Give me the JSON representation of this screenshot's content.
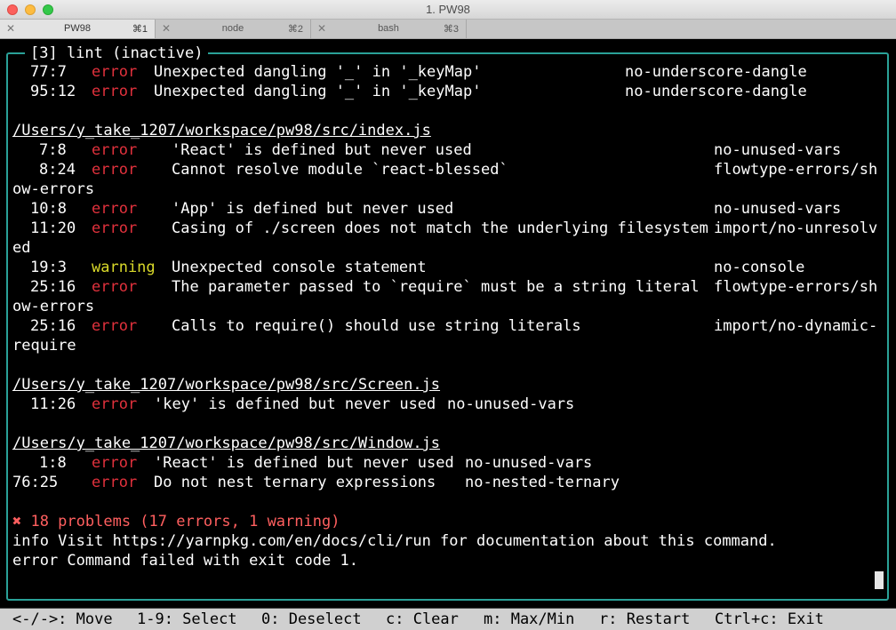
{
  "window": {
    "title": "1. PW98"
  },
  "tabs": [
    {
      "name": "PW98",
      "shortcut": "⌘1",
      "close": "✕"
    },
    {
      "name": "node",
      "shortcut": "⌘2",
      "close": "✕"
    },
    {
      "name": "bash",
      "shortcut": "⌘3",
      "close": "✕"
    }
  ],
  "panel": {
    "title": "[3] lint (inactive)"
  },
  "terminal": {
    "prev": [
      {
        "loc": "77:7",
        "level": "error",
        "msg": "Unexpected dangling '_' in '_keyMap'",
        "rule": "no-underscore-dangle"
      },
      {
        "loc": "95:12",
        "level": "error",
        "msg": "Unexpected dangling '_' in '_keyMap'",
        "rule": "no-underscore-dangle"
      }
    ],
    "index_path": "/Users/y_take_1207/workspace/pw98/src/index.js",
    "index": [
      {
        "loc": "7:8",
        "level": "error",
        "msg": "'React' is defined but never used",
        "rule": "no-unused-vars"
      },
      {
        "loc": "8:24",
        "level": "error",
        "msg": "Cannot resolve module `react-blessed`",
        "rule": "flowtype-errors/sh"
      },
      {
        "wrap": "ow-errors"
      },
      {
        "loc": "10:8",
        "level": "error",
        "msg": "'App' is defined but never used",
        "rule": "no-unused-vars"
      },
      {
        "loc": "11:20",
        "level": "error",
        "msg": "Casing of ./screen does not match the underlying filesystem",
        "rule": "import/no-unresolv"
      },
      {
        "wrap": "ed"
      },
      {
        "loc": "19:3",
        "level": "warning",
        "msg": "Unexpected console statement",
        "rule": "no-console"
      },
      {
        "loc": "25:16",
        "level": "error",
        "msg": "The parameter passed to `require` must be a string literal",
        "rule": "flowtype-errors/sh"
      },
      {
        "wrap": "ow-errors"
      },
      {
        "loc": "25:16",
        "level": "error",
        "msg": "Calls to require() should use string literals",
        "rule": "import/no-dynamic-"
      },
      {
        "wrap": "require"
      }
    ],
    "screen_path": "/Users/y_take_1207/workspace/pw98/src/Screen.js",
    "screen": [
      {
        "loc": "11:26",
        "level": "error",
        "msg": "'key' is defined but never used",
        "rule": "no-unused-vars"
      }
    ],
    "window_path": "/Users/y_take_1207/workspace/pw98/src/Window.js",
    "window_file": [
      {
        "loc": "1:8",
        "level": "error",
        "msg": "'React' is defined but never used",
        "rule": "no-unused-vars"
      },
      {
        "loc": "76:25",
        "level": "error",
        "msg": "Do not nest ternary expressions",
        "rule": "no-nested-ternary"
      }
    ],
    "summary": "✖ 18 problems (17 errors, 1 warning)",
    "info": "info Visit https://yarnpkg.com/en/docs/cli/run for documentation about this command.",
    "failed": "error Command failed with exit code 1."
  },
  "statusbar": {
    "move": "<-/->: Move",
    "select": "1-9: Select",
    "deselect": "0: Deselect",
    "clear": "c: Clear",
    "maxmin": "m: Max/Min",
    "restart": "r: Restart",
    "exit": "Ctrl+c: Exit"
  },
  "colors": {
    "border": "#2aa198",
    "error": "#e0313c",
    "warning": "#dada2a",
    "summary": "#ff5f5f"
  }
}
